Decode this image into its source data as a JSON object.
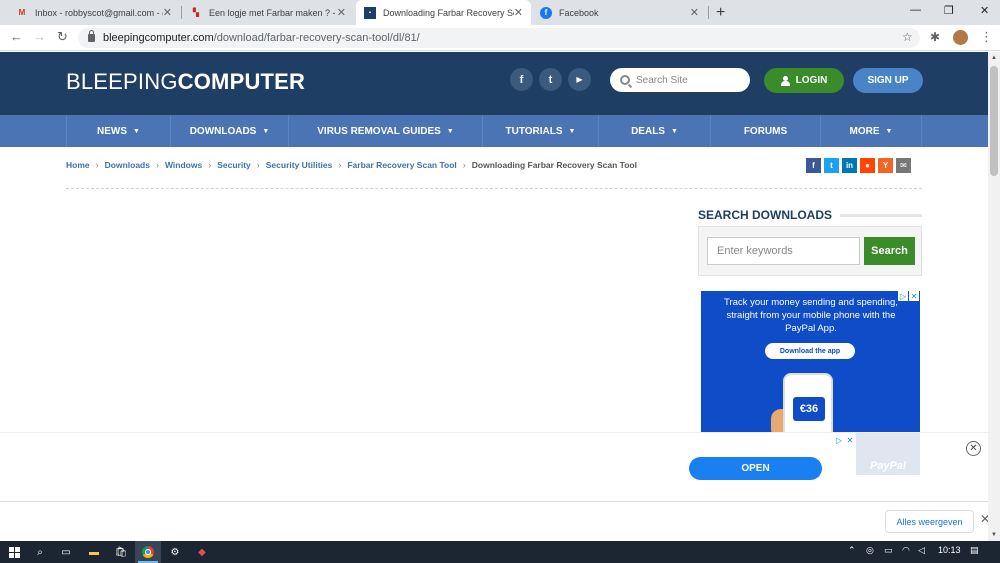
{
  "browser": {
    "tabs": [
      {
        "title": "Inbox - robbyscot@gmail.com - (",
        "favicon": "gmail-icon",
        "active": false
      },
      {
        "title": "Een logje met Farbar maken ? - B",
        "favicon": "forum-icon",
        "active": false
      },
      {
        "title": "Downloading Farbar Recovery Sc",
        "favicon": "bleepingcomputer-icon",
        "active": true
      },
      {
        "title": "Facebook",
        "favicon": "facebook-icon",
        "active": false
      }
    ],
    "url_host": "bleepingcomputer.com",
    "url_path": "/download/farbar-recovery-scan-tool/dl/81/"
  },
  "site": {
    "logo_light": "BLEEPING",
    "logo_bold": "COMPUTER",
    "search_placeholder": "Search Site",
    "login_label": "LOGIN",
    "signup_label": "SIGN UP",
    "nav": [
      "NEWS",
      "DOWNLOADS",
      "VIRUS REMOVAL GUIDES",
      "TUTORIALS",
      "DEALS",
      "FORUMS",
      "MORE"
    ],
    "breadcrumb": [
      "Home",
      "Downloads",
      "Windows",
      "Security",
      "Security Utilities",
      "Farbar Recovery Scan Tool",
      "Downloading Farbar Recovery Scan Tool"
    ],
    "sidebar": {
      "title": "SEARCH DOWNLOADS",
      "input_placeholder": "Enter keywords",
      "search_label": "Search"
    }
  },
  "ad": {
    "text": "Track your money sending and spending, straight from your mobile phone with the PayPal App.",
    "cta": "Download the app",
    "amount": "€36",
    "bottom_cta": "OPEN",
    "brand": "PayPal"
  },
  "download_bar": {
    "show_all_label": "Alles weergeven"
  },
  "taskbar": {
    "time": "10:13"
  },
  "colors": {
    "header": "#1e3e63",
    "nav": "#4b74b5",
    "green": "#3b8b2a",
    "ad_blue": "#0f4cc7"
  }
}
